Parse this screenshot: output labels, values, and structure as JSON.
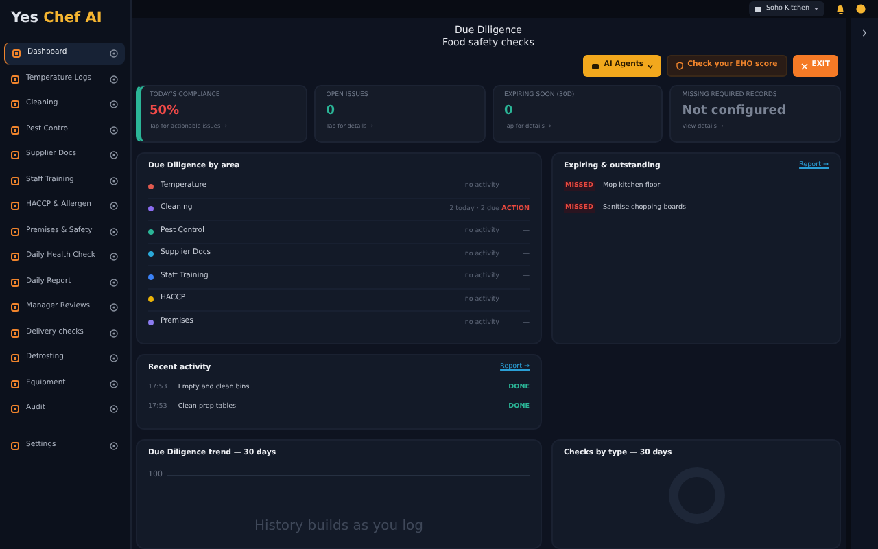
{
  "brand": {
    "first": "Yes",
    "second": "Chef AI"
  },
  "sidebar": {
    "items": [
      {
        "label": "Dashboard",
        "selected": true
      },
      {
        "label": "Temperature Logs",
        "selected": false
      },
      {
        "label": "Cleaning",
        "selected": false
      },
      {
        "label": "Pest Control",
        "selected": false
      },
      {
        "label": "Supplier Docs",
        "selected": false
      },
      {
        "label": "Staff Training",
        "selected": false
      },
      {
        "label": "HACCP & Allergen",
        "selected": false
      },
      {
        "label": "Premises & Safety",
        "selected": false
      },
      {
        "label": "Daily Health Check",
        "selected": false
      },
      {
        "label": "Daily Report",
        "selected": false
      },
      {
        "label": "Manager Reviews",
        "selected": false
      },
      {
        "label": "Delivery checks",
        "selected": false
      },
      {
        "label": "Defrosting",
        "selected": false
      },
      {
        "label": "Equipment",
        "selected": false
      },
      {
        "label": "Audit",
        "selected": false
      },
      {
        "label": "Settings",
        "selected": false
      }
    ]
  },
  "topbar": {
    "location": "Soho Kitchen"
  },
  "page": {
    "title": "Due Diligence",
    "subtitle": "Food safety checks"
  },
  "actions": [
    {
      "kind": "agents",
      "label": "AI Agents"
    },
    {
      "kind": "eho",
      "label": "Check your EHO score"
    },
    {
      "kind": "exit",
      "label": "EXIT"
    }
  ],
  "stats": [
    {
      "label": "TODAY'S COMPLIANCE",
      "value": "50%",
      "hint": "Tap for actionable issues →",
      "kind": "danger",
      "highlighted": true
    },
    {
      "label": "OPEN ISSUES",
      "value": "0",
      "hint": "Tap for details →",
      "kind": "ok",
      "highlighted": false
    },
    {
      "label": "EXPIRING SOON (30D)",
      "value": "0",
      "hint": "Tap for details →",
      "kind": "ok",
      "highlighted": false
    },
    {
      "label": "MISSING REQUIRED RECORDS",
      "value": "Not configured",
      "hint": "View details →",
      "kind": "muted",
      "highlighted": false
    }
  ],
  "areas": {
    "title": "Due Diligence by area",
    "rows": [
      {
        "name": "Temperature",
        "color": "#e05a4f",
        "status": "no activity",
        "flag": "—",
        "kind": "idle"
      },
      {
        "name": "Cleaning",
        "color": "#8b6cf0",
        "status": "2 today · 2 due",
        "flag": "ACTION",
        "kind": "action"
      },
      {
        "name": "Pest Control",
        "color": "#2bb597",
        "status": "no activity",
        "flag": "—",
        "kind": "idle"
      },
      {
        "name": "Supplier Docs",
        "color": "#2aa8d8",
        "status": "no activity",
        "flag": "—",
        "kind": "idle"
      },
      {
        "name": "Staff Training",
        "color": "#3b82f6",
        "status": "no activity",
        "flag": "—",
        "kind": "idle"
      },
      {
        "name": "HACCP",
        "color": "#eab308",
        "status": "no activity",
        "flag": "—",
        "kind": "idle"
      },
      {
        "name": "Premises",
        "color": "#8b7cf0",
        "status": "no activity",
        "flag": "—",
        "kind": "idle"
      }
    ]
  },
  "expiring": {
    "title": "Expiring & outstanding",
    "link": "Report →",
    "items": [
      {
        "tag": "MISSED",
        "text": "Mop kitchen floor"
      },
      {
        "tag": "MISSED",
        "text": "Sanitise chopping boards"
      }
    ]
  },
  "recent": {
    "title": "Recent activity",
    "link": "Report →",
    "items": [
      {
        "time": "17:53",
        "text": "Empty and clean bins",
        "status": "DONE"
      },
      {
        "time": "17:53",
        "text": "Clean prep tables",
        "status": "DONE"
      }
    ]
  },
  "trend": {
    "title": "Due Diligence trend — 30 days",
    "ytick": "100",
    "message": "History builds as you log"
  },
  "checks_by_type": {
    "title": "Checks by type — 30 days"
  }
}
